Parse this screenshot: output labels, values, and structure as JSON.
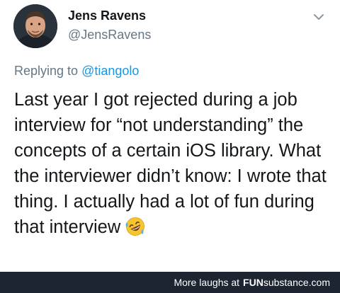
{
  "tweet": {
    "author_name": "Jens Ravens",
    "author_handle": "@JensRavens",
    "reply_prefix": "Replying to",
    "reply_to": "@tiangolo",
    "text": "Last year I got rejected during a job interview for “not understanding” the concepts of a certain iOS library. What the interviewer didn’t know: I wrote that thing. I actually had a lot of fun during that interview",
    "emoji_icon": "rolling-on-the-floor-laughing-emoji"
  },
  "footer": {
    "prefix": "More laughs at",
    "brand_fun": "FUN",
    "brand_rest": "substance.com"
  },
  "colors": {
    "text": "#14171a",
    "muted": "#657786",
    "link": "#1b95e0",
    "footer_bg": "#1d2532"
  }
}
